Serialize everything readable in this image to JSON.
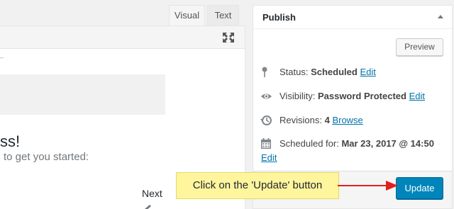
{
  "editor": {
    "tabs": {
      "visual": "Visual",
      "text": "Text"
    },
    "tiny_mark": "_",
    "heading_fragment": "ss!",
    "subline_fragment": "to get you started:",
    "next_label": "Next"
  },
  "publish": {
    "title": "Publish",
    "preview_label": "Preview",
    "status": {
      "label": "Status: ",
      "value": "Scheduled",
      "edit": "Edit"
    },
    "visibility": {
      "label": "Visibility: ",
      "value": "Password Protected",
      "edit": "Edit"
    },
    "revisions": {
      "label": "Revisions: ",
      "value": "4",
      "browse": "Browse"
    },
    "schedule": {
      "label": "Scheduled for: ",
      "value": "Mar 23, 2017 @ 14:50",
      "edit": "Edit"
    },
    "update_label": "Update"
  },
  "annotation": {
    "callout_text": "Click on the 'Update' button",
    "arrow_color": "#e0211c",
    "callout_color": "#fff59d"
  },
  "colors": {
    "primary_button": "#0085ba",
    "link": "#0073aa"
  },
  "icons": {
    "fullscreen": "fullscreen-icon",
    "collapse": "triangle-up-icon",
    "status": "pin-icon",
    "visibility": "eye-icon",
    "revisions": "history-icon",
    "schedule": "calendar-icon",
    "pen": "pen-icon"
  }
}
